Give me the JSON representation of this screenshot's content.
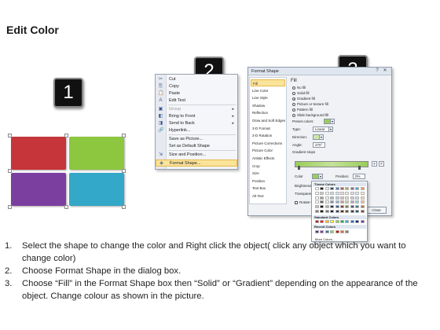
{
  "title": "Edit Color",
  "badges": [
    "1",
    "2",
    "3"
  ],
  "step1": {
    "shape_colors": [
      "#c6353a",
      "#8dc63f",
      "#7b3fa0",
      "#34a8c8"
    ]
  },
  "context_menu": {
    "items": [
      {
        "icon": "cut-icon",
        "glyph": "✂",
        "label": "Cut",
        "disabled": false,
        "submenu": false
      },
      {
        "icon": "copy-icon",
        "glyph": "⎘",
        "label": "Copy",
        "disabled": false,
        "submenu": false
      },
      {
        "icon": "paste-icon",
        "glyph": "📋",
        "label": "Paste",
        "disabled": false,
        "submenu": false
      },
      {
        "icon": "edit-text-icon",
        "glyph": "A",
        "label": "Edit Text",
        "disabled": false,
        "submenu": false
      },
      {
        "icon": "group-icon",
        "glyph": "▣",
        "label": "Group",
        "disabled": true,
        "submenu": true
      },
      {
        "icon": "bring-to-front-icon",
        "glyph": "◧",
        "label": "Bring to Front",
        "disabled": false,
        "submenu": true
      },
      {
        "icon": "send-to-back-icon",
        "glyph": "◨",
        "label": "Send to Back",
        "disabled": false,
        "submenu": true
      },
      {
        "icon": "hyperlink-icon",
        "glyph": "🔗",
        "label": "Hyperlink...",
        "disabled": false,
        "submenu": false
      },
      {
        "icon": "save-picture-icon",
        "glyph": "",
        "label": "Save as Picture...",
        "disabled": false,
        "submenu": false
      },
      {
        "icon": "default-shape-icon",
        "glyph": "",
        "label": "Set as Default Shape",
        "disabled": false,
        "submenu": false
      },
      {
        "icon": "size-position-icon",
        "glyph": "⇲",
        "label": "Size and Position...",
        "disabled": false,
        "submenu": false
      },
      {
        "icon": "format-shape-icon",
        "glyph": "◈",
        "label": "Format Shape...",
        "disabled": false,
        "submenu": false,
        "highlight": true
      }
    ]
  },
  "format_dialog": {
    "title": "Format Shape",
    "close_label": "Close",
    "nav": [
      "Fill",
      "Line Color",
      "Line Style",
      "Shadow",
      "Reflection",
      "Glow and Soft Edges",
      "3-D Format",
      "3-D Rotation",
      "Picture Corrections",
      "Picture Color",
      "Artistic Effects",
      "Crop",
      "Size",
      "Position",
      "Text Box",
      "Alt Text"
    ],
    "fill_heading": "Fill",
    "fill_options": [
      {
        "label": "No fill",
        "type": "radio",
        "on": false
      },
      {
        "label": "Solid fill",
        "type": "radio",
        "on": false
      },
      {
        "label": "Gradient fill",
        "type": "radio",
        "on": true
      },
      {
        "label": "Picture or texture fill",
        "type": "radio",
        "on": false
      },
      {
        "label": "Pattern fill",
        "type": "radio",
        "on": false
      },
      {
        "label": "Slide background fill",
        "type": "radio",
        "on": false
      }
    ],
    "preset_colors_label": "Preset colors:",
    "type_label": "Type:",
    "type_value": "Linear",
    "direction_label": "Direction:",
    "angle_label": "Angle:",
    "angle_value": "270°",
    "gradient_stops_label": "Gradient stops",
    "color_label": "Color",
    "position_label": "Position:",
    "position_value": "0%",
    "brightness_label": "Brightness:",
    "transparency_label": "Transparency:",
    "rotate_label": "Rotate with shape"
  },
  "color_popup": {
    "theme_colors_label": "Theme Colors",
    "standard_colors_label": "Standard Colors",
    "recent_colors_label": "Recent Colors",
    "more_colors_label": "More Colors...",
    "theme_row": [
      "#ffffff",
      "#000000",
      "#eeece1",
      "#1f497d",
      "#4f81bd",
      "#c0504d",
      "#9bbb59",
      "#8064a2",
      "#4bacc6",
      "#f79646"
    ],
    "standard": [
      "#c00000",
      "#ff0000",
      "#ffc000",
      "#ffff00",
      "#92d050",
      "#00b050",
      "#00b0f0",
      "#0070c0",
      "#002060",
      "#7030a0"
    ],
    "recent": [
      "#4b2e83",
      "#7d3c98",
      "#2e75b6",
      "#92d050",
      "#c00000",
      "#e46c0a",
      "#7f7f7f"
    ]
  },
  "steps": [
    {
      "num": "1.",
      "text": "Select the shape to change the color and Right click the object( click any object which you want to change color)"
    },
    {
      "num": "2.",
      "text": "Choose Format Shape in the dialog box."
    },
    {
      "num": "3.",
      "text": "Choose “Fill” in the Format Shape box then “Solid” or “Gradient” depending on the appearance of the object. Change colour as shown in the picture."
    }
  ]
}
